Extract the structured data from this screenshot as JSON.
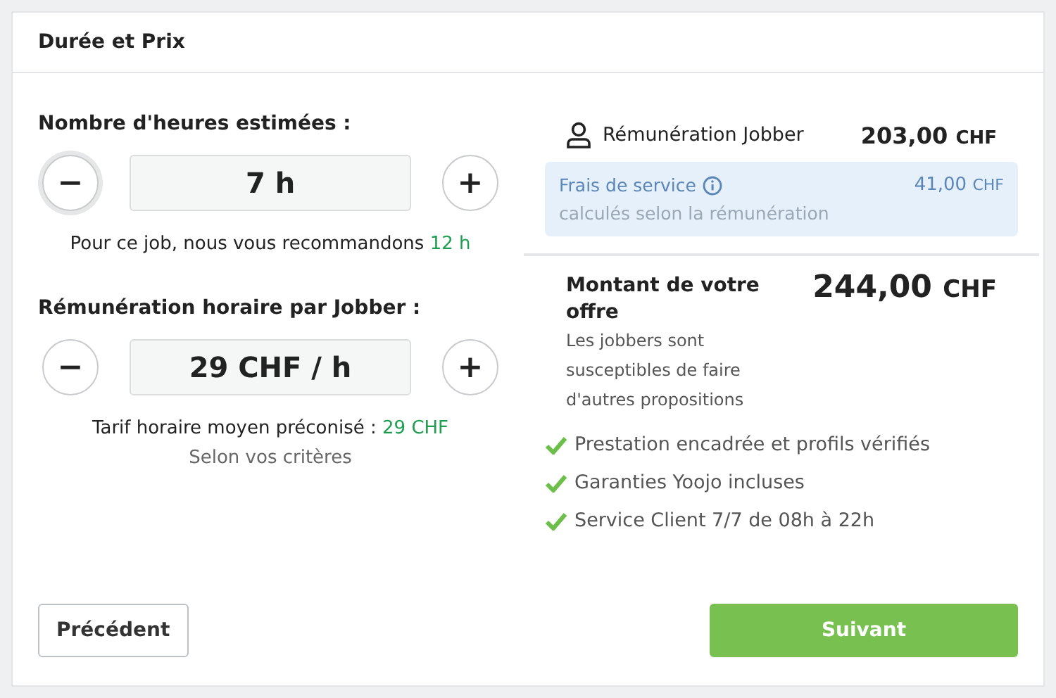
{
  "card": {
    "title": "Durée et Prix"
  },
  "steppers": [
    {
      "label": "Nombre d'heures estimées :",
      "value": "7 h",
      "decrement": "−",
      "increment": "+",
      "decrement_focused": true,
      "hint": "Pour ce job, nous vous recommandons",
      "hint_highlight": "12 h"
    },
    {
      "label": "Rémunération horaire par Jobber :",
      "value": "29 CHF / h",
      "decrement": "−",
      "increment": "+",
      "decrement_focused": false,
      "hint": "Tarif horaire moyen préconisé :",
      "hint_highlight": "29 CHF",
      "subhint": "Selon vos critères"
    }
  ],
  "summary": {
    "jobber": {
      "label": "Rémunération Jobber",
      "amount": "203,00",
      "currency": "CHF"
    },
    "fees": {
      "label": "Frais de service",
      "note": "calculés selon la rémunération",
      "amount": "41,00",
      "currency": "CHF"
    },
    "total": {
      "label": "Montant de votre offre",
      "note": "Les jobbers sont susceptibles de faire d'autres propositions",
      "amount": "244,00",
      "currency": "CHF"
    },
    "guarantees": [
      "Prestation encadrée et profils vérifiés",
      "Garanties Yoojo incluses",
      "Service Client 7/7 de 08h à 22h"
    ]
  },
  "buttons": {
    "back": "Précédent",
    "next": "Suivant"
  }
}
